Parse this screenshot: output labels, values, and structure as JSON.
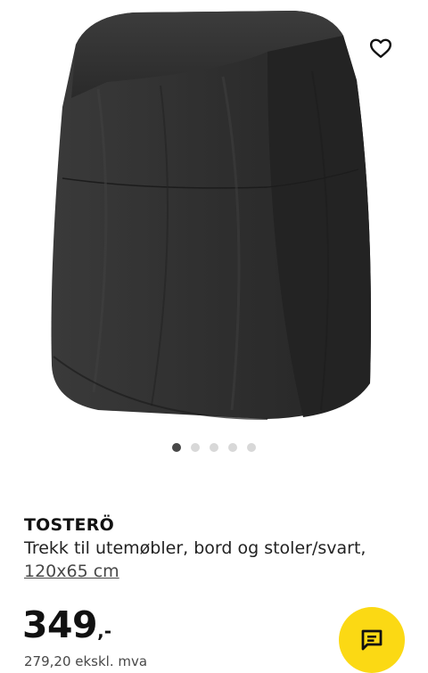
{
  "product": {
    "name": "TOSTERÖ",
    "description": "Trekk til utemøbler, bord og stoler/svart,",
    "size": "120x65 cm"
  },
  "price": {
    "integer": "349",
    "suffix": ",-",
    "excl_vat": "279,20 ekskl. mva"
  },
  "gallery": {
    "slide_count": 5,
    "active_index": 0
  },
  "icons": {
    "favourite": "heart-outline-icon",
    "chat": "chat-bubble-icon"
  },
  "colors": {
    "chat_button": "#fbd914",
    "dot_active": "#484848",
    "dot_inactive": "#d8d8d8",
    "product_fabric": "#2e2e2e"
  }
}
